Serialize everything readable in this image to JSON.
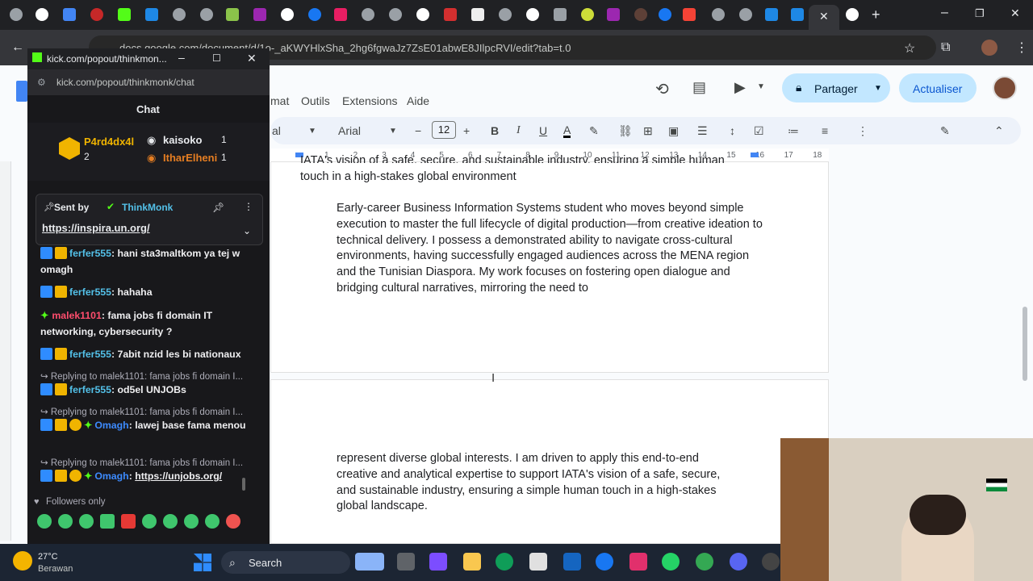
{
  "browser": {
    "url": "docs.google.com/document/d/1o-_aKWYHlxSha_2hg6fgwaJz7ZsE01abwE8JIlpcRVI/edit?tab=t.0",
    "new_tab_icon": "plus-icon"
  },
  "docs": {
    "menu": [
      "mat",
      "Outils",
      "Extensions",
      "Aide"
    ],
    "share_label": "Partager",
    "update_label": "Actualiser",
    "font_name": "Arial",
    "font_size": "12",
    "style_label": "al",
    "ruler_numbers": [
      "1",
      "2",
      "3",
      "4",
      "5",
      "6",
      "7",
      "8",
      "9",
      "10",
      "11",
      "12",
      "13",
      "14",
      "15",
      "16",
      "17",
      "18"
    ],
    "page1_top_line": "IATA's vision of a safe, secure, and sustainable industry, ensuring a simple human",
    "page1_line2": "touch in a high-stakes global environment",
    "page1_paragraph": "Early-career Business Information Systems student who moves beyond simple execution to master the full lifecycle of digital production—from creative ideation to technical delivery. I possess a demonstrated ability to navigate cross-cultural environments, having successfully engaged audiences across the MENA region and the Tunisian Diaspora. My work focuses on fostering open dialogue and bridging cultural narratives, mirroring the need to",
    "page2_paragraph": "represent diverse global interests. I am driven to apply this end-to-end creative and analytical expertise to support IATA's vision of a safe, secure, and sustainable industry, ensuring a simple human touch in a high-stakes global landscape."
  },
  "kick": {
    "window_title": "kick.com/popout/thinkmon...",
    "url": "kick.com/popout/thinkmonk/chat",
    "chat_title": "Chat",
    "leaderboard": {
      "top_user": "P4rd4dx4l",
      "top_count": "2",
      "user2": "kaisoko",
      "user2_count": "1",
      "user3": "ItharElheni",
      "user3_count": "1"
    },
    "pinned": {
      "sent_by": "Sent by",
      "channel": "ThinkMonk",
      "link": "https://inspira.un.org/"
    },
    "messages": [
      {
        "user": "ferfer555",
        "text": ": hani sta3maltkom ya tej w omagh",
        "color": "#53c0e8"
      },
      {
        "user": "ferfer555",
        "text": ": hahaha",
        "color": "#53c0e8"
      },
      {
        "user": "malek1101",
        "text": ": fama jobs fi domain IT networking, cybersecurity ?",
        "color": "#ff4d6d"
      },
      {
        "user": "ferfer555",
        "text": ": 7abit nzid les bi nationaux",
        "color": "#53c0e8"
      },
      {
        "user": "ferfer555",
        "text": ": od5el UNJOBs",
        "color": "#53c0e8"
      },
      {
        "user": "Omagh",
        "text": ": lawej base fama menou",
        "color": "#3d8bff"
      },
      {
        "user": "Omagh",
        "text": ": ",
        "color": "#3d8bff",
        "link": "https://unjobs.org/"
      }
    ],
    "reply_text": "Replying to malek1101: fama jobs fi domain I...",
    "followers_only": "Followers only"
  },
  "taskbar": {
    "weather_temp": "27°C",
    "weather_desc": "Berawan",
    "search_label": "Search"
  }
}
